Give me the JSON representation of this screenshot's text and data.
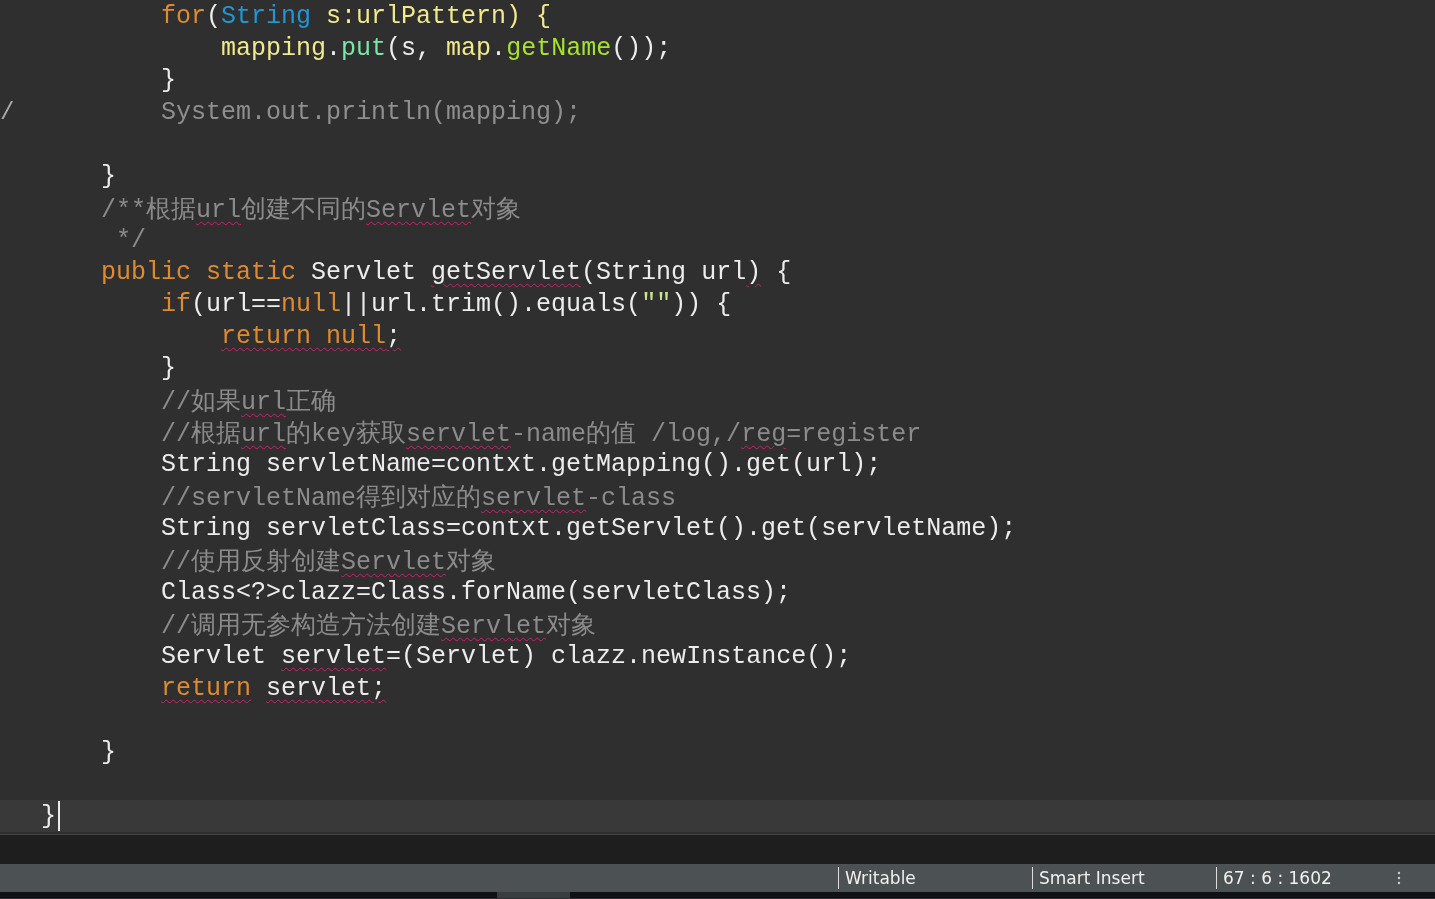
{
  "editor": {
    "lines": [
      {
        "kind": "code",
        "tokens": [
          {
            "t": "        for",
            "kind": "keyword"
          },
          {
            "t": "(",
            "kind": "plain"
          },
          {
            "t": "String",
            "kind": "type"
          },
          {
            "t": " s:urlPattern) {",
            "kind": "field"
          }
        ]
      },
      {
        "kind": "code",
        "tokens": [
          {
            "t": "            mapping",
            "kind": "field"
          },
          {
            "t": ".",
            "kind": "plain"
          },
          {
            "t": "put",
            "kind": "method"
          },
          {
            "t": "(s, ",
            "kind": "plain"
          },
          {
            "t": "map",
            "kind": "field"
          },
          {
            "t": ".",
            "kind": "plain"
          },
          {
            "t": "getName",
            "kind": "call"
          },
          {
            "t": "());",
            "kind": "plain"
          }
        ]
      },
      {
        "kind": "code",
        "tokens": [
          {
            "t": "        }",
            "kind": "plain"
          }
        ]
      },
      {
        "kind": "code",
        "gutter": "/",
        "tokens": [
          {
            "t": "        System.out.println(mapping);",
            "kind": "disabled"
          }
        ]
      },
      {
        "kind": "blank"
      },
      {
        "kind": "code",
        "tokens": [
          {
            "t": "    }",
            "kind": "plain"
          }
        ]
      },
      {
        "kind": "code",
        "tokens": [
          {
            "t": "    /**根据",
            "kind": "comment"
          },
          {
            "t": "url",
            "kind": "comment",
            "squiggle": true
          },
          {
            "t": "创建不同的",
            "kind": "comment"
          },
          {
            "t": "Servlet",
            "kind": "comment",
            "squiggle": true
          },
          {
            "t": "对象",
            "kind": "comment"
          }
        ]
      },
      {
        "kind": "code",
        "tokens": [
          {
            "t": "     */",
            "kind": "comment"
          }
        ]
      },
      {
        "kind": "code",
        "tokens": [
          {
            "t": "    public static",
            "kind": "keyword"
          },
          {
            "t": " Servlet ",
            "kind": "plain"
          },
          {
            "t": "getServlet",
            "kind": "plain",
            "squiggle": true
          },
          {
            "t": "(String url",
            "kind": "plain"
          },
          {
            "t": ")",
            "kind": "plain",
            "squiggle": true
          },
          {
            "t": " {",
            "kind": "plain"
          }
        ]
      },
      {
        "kind": "code",
        "tokens": [
          {
            "t": "        if",
            "kind": "keyword"
          },
          {
            "t": "(url==",
            "kind": "plain"
          },
          {
            "t": "null",
            "kind": "keyword"
          },
          {
            "t": "||url.trim().equals(",
            "kind": "plain"
          },
          {
            "t": "\"\"",
            "kind": "string"
          },
          {
            "t": ")) {",
            "kind": "plain"
          }
        ]
      },
      {
        "kind": "code",
        "tokens": [
          {
            "t": "            return null",
            "kind": "keyword",
            "squiggle": true
          },
          {
            "t": ";",
            "kind": "plain",
            "squiggle": true
          }
        ]
      },
      {
        "kind": "code",
        "tokens": [
          {
            "t": "        }",
            "kind": "plain"
          }
        ]
      },
      {
        "kind": "code",
        "tokens": [
          {
            "t": "        //如果",
            "kind": "comment"
          },
          {
            "t": "url",
            "kind": "comment",
            "squiggle": true
          },
          {
            "t": "正确",
            "kind": "comment"
          }
        ]
      },
      {
        "kind": "code",
        "tokens": [
          {
            "t": "        //根据",
            "kind": "comment"
          },
          {
            "t": "url",
            "kind": "comment",
            "squiggle": true
          },
          {
            "t": "的key获取",
            "kind": "comment"
          },
          {
            "t": "servlet",
            "kind": "comment",
            "squiggle": true
          },
          {
            "t": "-name的值 /log,/",
            "kind": "comment"
          },
          {
            "t": "reg",
            "kind": "comment",
            "squiggle": true
          },
          {
            "t": "=register",
            "kind": "comment"
          }
        ]
      },
      {
        "kind": "code",
        "tokens": [
          {
            "t": "        String servletName=contxt.getMapping().get(url);",
            "kind": "plain"
          }
        ]
      },
      {
        "kind": "code",
        "tokens": [
          {
            "t": "        //servletName得到对应的",
            "kind": "comment"
          },
          {
            "t": "servlet",
            "kind": "comment",
            "squiggle": true
          },
          {
            "t": "-class",
            "kind": "comment"
          }
        ]
      },
      {
        "kind": "code",
        "tokens": [
          {
            "t": "        String servletClass=contxt.getServlet().get(servletName);",
            "kind": "plain"
          }
        ]
      },
      {
        "kind": "code",
        "tokens": [
          {
            "t": "        //使用反射创建",
            "kind": "comment"
          },
          {
            "t": "Servlet",
            "kind": "comment",
            "squiggle": true
          },
          {
            "t": "对象",
            "kind": "comment"
          }
        ]
      },
      {
        "kind": "code",
        "tokens": [
          {
            "t": "        Class<?>clazz=Class.forName(servletClass);",
            "kind": "plain"
          }
        ]
      },
      {
        "kind": "code",
        "tokens": [
          {
            "t": "        //调用无参构造方法创建",
            "kind": "comment"
          },
          {
            "t": "Servlet",
            "kind": "comment",
            "squiggle": true
          },
          {
            "t": "对象",
            "kind": "comment"
          }
        ]
      },
      {
        "kind": "code",
        "tokens": [
          {
            "t": "        Servlet ",
            "kind": "plain"
          },
          {
            "t": "servlet",
            "kind": "plain",
            "squiggle": true
          },
          {
            "t": "=(Servlet) clazz.newInstance();",
            "kind": "plain"
          }
        ]
      },
      {
        "kind": "code",
        "tokens": [
          {
            "t": "        return",
            "kind": "keyword",
            "squiggle": true
          },
          {
            "t": " servlet;",
            "kind": "plain",
            "squiggle": true
          }
        ]
      },
      {
        "kind": "blank"
      },
      {
        "kind": "code",
        "tokens": [
          {
            "t": "    }",
            "kind": "plain"
          }
        ]
      },
      {
        "kind": "blank"
      },
      {
        "kind": "code",
        "current": true,
        "tokens": [
          {
            "t": "}",
            "kind": "plain"
          }
        ]
      }
    ]
  },
  "status_bar": {
    "items": [
      "Writable",
      "Smart Insert",
      "67 : 6 : 1602"
    ]
  }
}
